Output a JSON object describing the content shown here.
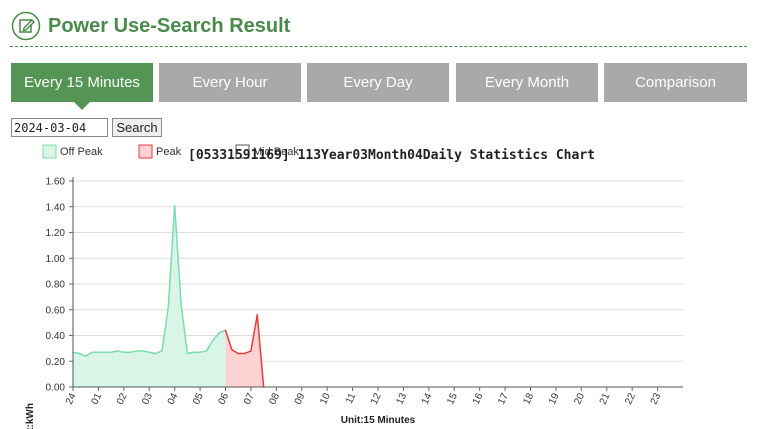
{
  "header": {
    "title": "Power Use-Search Result",
    "icon": "edit-icon",
    "accent_color": "#4a8a4a"
  },
  "tabs": [
    {
      "label": "Every 15 Minutes",
      "active": true
    },
    {
      "label": "Every Hour",
      "active": false
    },
    {
      "label": "Every Day",
      "active": false
    },
    {
      "label": "Every Month",
      "active": false
    },
    {
      "label": "Comparison",
      "active": false
    }
  ],
  "colors": {
    "tab_active": "#549455",
    "tab_inactive": "#a9a9a9",
    "off_peak_fill": "#d9f5e8",
    "off_peak_line": "#7ddcaa",
    "peak_fill": "#ffd3d3",
    "peak_line": "#e83a3a",
    "grid": "#dddddd"
  },
  "search": {
    "date_value": "2024-03-04",
    "button_label": "Search"
  },
  "chart_data": {
    "type": "area",
    "title": "[05331591169] 113Year03Month04Daily Statistics Chart",
    "ylabel": "Unit:kWh",
    "xlabel": "Unit:15 Minutes",
    "ylim": [
      0,
      1.6
    ],
    "y_ticks": [
      "0.00",
      "0.20",
      "0.40",
      "0.60",
      "0.80",
      "1.00",
      "1.20",
      "1.40",
      "1.60"
    ],
    "x_ticks": [
      "24",
      "01",
      "02",
      "03",
      "04",
      "05",
      "06",
      "07",
      "08",
      "09",
      "10",
      "11",
      "12",
      "13",
      "14",
      "15",
      "16",
      "17",
      "18",
      "19",
      "20",
      "21",
      "22",
      "23"
    ],
    "grid": true,
    "legend_position": "top-left",
    "legend": [
      {
        "name": "Off Peak",
        "color_key": "off_peak"
      },
      {
        "name": "Peak",
        "color_key": "peak"
      },
      {
        "name": "Mid Peak",
        "color_key": "mid_peak"
      }
    ],
    "series": [
      {
        "name": "Off Peak",
        "color_key": "off_peak",
        "x": [
          0,
          0.25,
          0.5,
          0.75,
          1,
          1.25,
          1.5,
          1.75,
          2,
          2.25,
          2.5,
          2.75,
          3,
          3.25,
          3.5,
          3.75,
          4,
          4.25,
          4.5,
          4.75,
          5,
          5.25,
          5.5,
          5.75,
          6
        ],
        "values": [
          0.27,
          0.26,
          0.24,
          0.27,
          0.27,
          0.27,
          0.27,
          0.28,
          0.27,
          0.27,
          0.28,
          0.28,
          0.27,
          0.26,
          0.28,
          0.62,
          1.41,
          0.65,
          0.26,
          0.27,
          0.27,
          0.28,
          0.36,
          0.42,
          0.44
        ]
      },
      {
        "name": "Peak",
        "color_key": "peak",
        "x": [
          6,
          6.25,
          6.5,
          6.75,
          7,
          7.25,
          7.5
        ],
        "values": [
          0.44,
          0.29,
          0.26,
          0.26,
          0.28,
          0.56,
          0
        ]
      }
    ]
  }
}
